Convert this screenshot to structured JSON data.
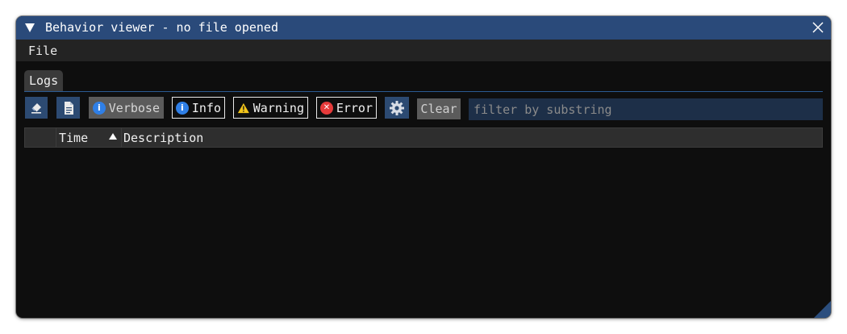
{
  "window": {
    "title": "Behavior viewer - no file opened"
  },
  "menu": {
    "file_label": "File"
  },
  "tabs": [
    {
      "label": "Logs"
    }
  ],
  "toolbar": {
    "verbose_label": "Verbose",
    "info_label": "Info",
    "warning_label": "Warning",
    "error_label": "Error",
    "clear_label": "Clear",
    "filter_placeholder": "filter by substring",
    "filter_value": ""
  },
  "table": {
    "columns": [
      "",
      "Time",
      "Description"
    ],
    "sorted_by": "Time",
    "rows": []
  },
  "icons": {
    "eraser": "eraser-icon",
    "copy": "copy-icon",
    "verbose": "info-icon",
    "info": "info-icon",
    "warning": "warning-icon",
    "error": "error-icon",
    "settings": "gear-icon",
    "close": "close-icon",
    "collapse": "collapse-arrow-icon"
  },
  "colors": {
    "title_bar": "#2a4a7a",
    "accent": "#2c4a72",
    "info_blue": "#2f7fe6",
    "warning_yellow": "#f2c51a",
    "error_red": "#e53a3a"
  }
}
